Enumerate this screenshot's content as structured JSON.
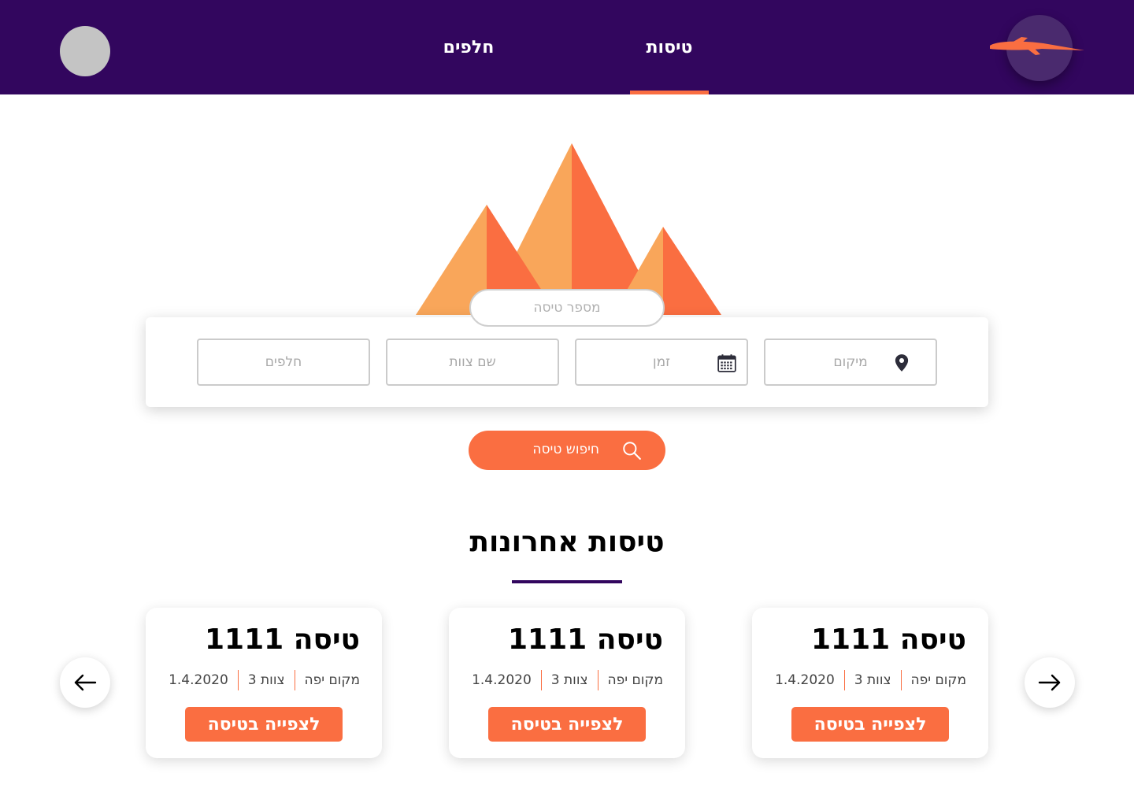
{
  "header": {
    "tabs": [
      {
        "label": "טיסות",
        "active": true
      },
      {
        "label": "חלפים",
        "active": false
      }
    ],
    "logo_icon": "airplane-icon",
    "avatar_icon": "avatar-placeholder"
  },
  "search": {
    "flight_number_placeholder": "מספר טיסה",
    "fields": {
      "location_placeholder": "מיקום",
      "time_placeholder": "זמן",
      "team_placeholder": "שם צוות",
      "shifts_placeholder": "חלפים"
    },
    "button_label": "חיפוש טיסה",
    "icons": {
      "location": "map-pin-icon",
      "time": "calendar-icon",
      "button": "search-icon"
    }
  },
  "recent": {
    "title": "טיסות אחרונות",
    "cards": [
      {
        "title": "טיסה 1111",
        "date": "1.4.2020",
        "team": "צוות 3",
        "place": "מקום יפה",
        "button": "לצפייה בטיסה"
      },
      {
        "title": "טיסה 1111",
        "date": "1.4.2020",
        "team": "צוות 3",
        "place": "מקום יפה",
        "button": "לצפייה בטיסה"
      },
      {
        "title": "טיסה 1111",
        "date": "1.4.2020",
        "team": "צוות 3",
        "place": "מקום יפה",
        "button": "לצפייה בטיסה"
      }
    ],
    "nav_icons": {
      "prev": "arrow-left-icon",
      "next": "arrow-right-icon"
    }
  },
  "colors": {
    "header_bg": "#32065e",
    "accent": "#fa6e41",
    "mountain_light": "#f9a65a",
    "avatar": "#c4c4c4"
  }
}
